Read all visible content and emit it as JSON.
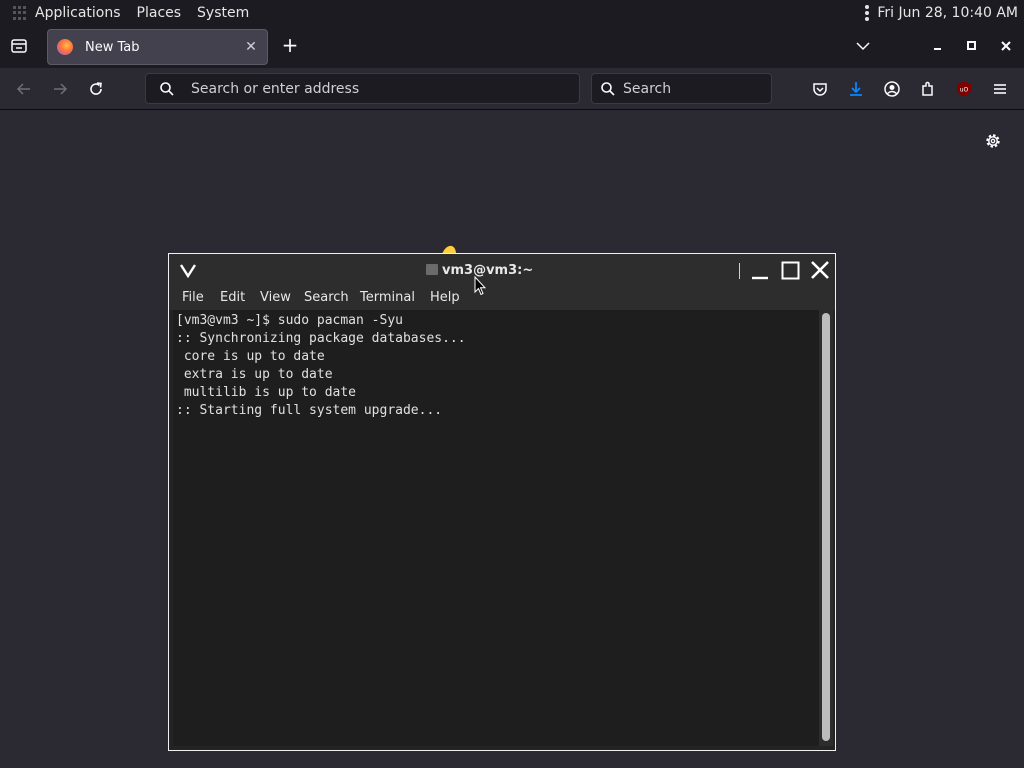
{
  "panel": {
    "menus": [
      "Applications",
      "Places",
      "System"
    ],
    "clock": "Fri Jun 28, 10:40 AM"
  },
  "browser": {
    "tab_title": "New Tab",
    "url_placeholder": "Search or enter address",
    "search_placeholder": "Search"
  },
  "terminal": {
    "title": "vm3@vm3:~",
    "menus": [
      "File",
      "Edit",
      "View",
      "Search",
      "Terminal",
      "Help"
    ],
    "lines": [
      "[vm3@vm3 ~]$ sudo pacman -Syu",
      ":: Synchronizing package databases...",
      " core is up to date",
      " extra is up to date",
      " multilib is up to date",
      ":: Starting full system upgrade..."
    ]
  },
  "icons": {
    "panel": [
      "apps-grid-icon",
      "kebab-menu-icon"
    ],
    "tabbar": [
      "list-all-tabs-icon",
      "firefox-icon",
      "close-tab-icon",
      "new-tab-icon",
      "chevron-down-icon",
      "minimize-icon",
      "maximize-icon",
      "close-window-icon"
    ],
    "navbar": [
      "back-icon",
      "forward-icon",
      "reload-icon",
      "search-icon",
      "pocket-icon",
      "download-icon",
      "account-icon",
      "extensions-icon",
      "ublock-icon",
      "hamburger-menu-icon"
    ],
    "content": [
      "settings-gear-icon"
    ],
    "terminal": [
      "vivaldi-logo-icon",
      "terminal-icon",
      "minimize-icon",
      "maximize-icon",
      "close-icon"
    ]
  },
  "colors": {
    "accent_download": "#0a84ff",
    "ublock_red": "#800000"
  }
}
